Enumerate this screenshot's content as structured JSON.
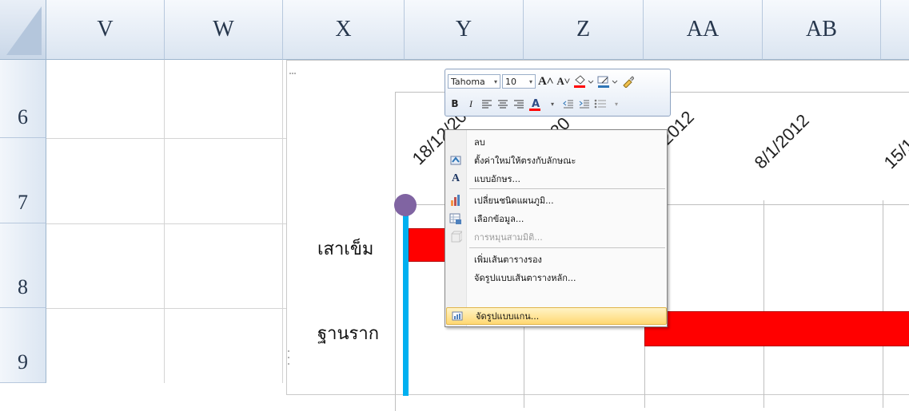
{
  "columns": [
    "V",
    "W",
    "X",
    "Y",
    "Z",
    "AA",
    "AB"
  ],
  "rows": [
    "6",
    "7",
    "8",
    "9"
  ],
  "chart": {
    "date_labels": [
      "18/12/20",
      "/20",
      "2012",
      "8/1/2012",
      "15/1"
    ],
    "categories": [
      "เสาเข็ม",
      "ฐานราก"
    ],
    "colors": {
      "bar": "#ff0000",
      "axis": "#00b0f0",
      "handle": "#8064a2"
    }
  },
  "mini_toolbar": {
    "font_name": "Tahoma",
    "font_size": "10",
    "grow_font": "A˄",
    "shrink_font": "A˅",
    "bold": "B",
    "italic": "I",
    "font_color": "A"
  },
  "context_menu": {
    "items": [
      {
        "label": "ลบ",
        "icon": "",
        "disabled": false
      },
      {
        "label": "ตั้งค่าใหม่ให้ตรงกับลักษณะ",
        "icon": "reset-style-icon",
        "disabled": false
      },
      {
        "label": "แบบอักษร...",
        "icon": "font-icon",
        "disabled": false
      },
      {
        "label": "เปลี่ยนชนิดแผนภูมิ...",
        "icon": "chart-type-icon",
        "disabled": false
      },
      {
        "label": "เลือกข้อมูล...",
        "icon": "select-data-icon",
        "disabled": false
      },
      {
        "label": "การหมุนสามมิติ...",
        "icon": "3d-rotation-icon",
        "disabled": true
      },
      {
        "label": "เพิ่มเส้นตารางรอง",
        "icon": "",
        "disabled": false
      },
      {
        "label": "จัดรูปแบบเส้นตารางหลัก...",
        "icon": "",
        "disabled": false
      },
      {
        "label": "จัดรูปแบบแกน...",
        "icon": "format-axis-icon",
        "disabled": false
      }
    ]
  }
}
